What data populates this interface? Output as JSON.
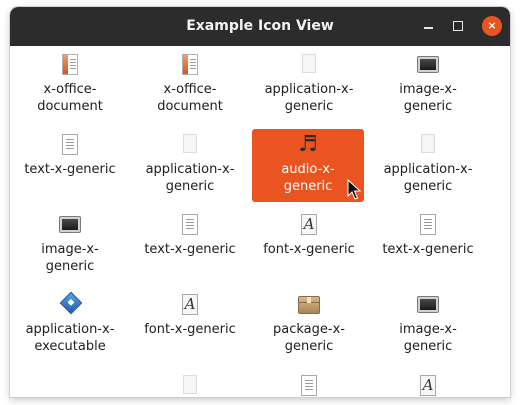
{
  "window": {
    "title": "Example Icon View"
  },
  "controls": {
    "minimize_glyph": "",
    "maximize_glyph": "",
    "close_glyph": "×"
  },
  "items": [
    {
      "label": "x-office-\ndocument",
      "icon": "office-document-icon"
    },
    {
      "label": "x-office-\ndocument",
      "icon": "office-document-icon"
    },
    {
      "label": "application-x-\ngeneric",
      "icon": "blank-file-icon"
    },
    {
      "label": "image-x-\ngeneric",
      "icon": "image-icon"
    },
    {
      "label": "text-x-generic",
      "icon": "text-file-icon"
    },
    {
      "label": "application-x-\ngeneric",
      "icon": "blank-file-icon"
    },
    {
      "label": "audio-x-\ngeneric",
      "icon": "audio-note-icon",
      "selected": true
    },
    {
      "label": "application-x-\ngeneric",
      "icon": "blank-file-icon"
    },
    {
      "label": "image-x-\ngeneric",
      "icon": "image-icon"
    },
    {
      "label": "text-x-generic",
      "icon": "text-file-icon"
    },
    {
      "label": "font-x-generic",
      "icon": "font-file-icon"
    },
    {
      "label": "text-x-generic",
      "icon": "text-file-icon"
    },
    {
      "label": "application-x-\nexecutable",
      "icon": "executable-icon"
    },
    {
      "label": "font-x-generic",
      "icon": "font-file-icon"
    },
    {
      "label": "package-x-\ngeneric",
      "icon": "package-icon"
    },
    {
      "label": "image-x-\ngeneric",
      "icon": "image-icon"
    },
    {
      "label": "",
      "icon": "blank-file-icon"
    },
    {
      "label": "",
      "icon": "text-file-icon"
    },
    {
      "label": "",
      "icon": "font-file-icon"
    }
  ],
  "colors": {
    "titlebar": "#2c2c2c",
    "accent": "#e95420",
    "selection_text": "#ffffff"
  }
}
